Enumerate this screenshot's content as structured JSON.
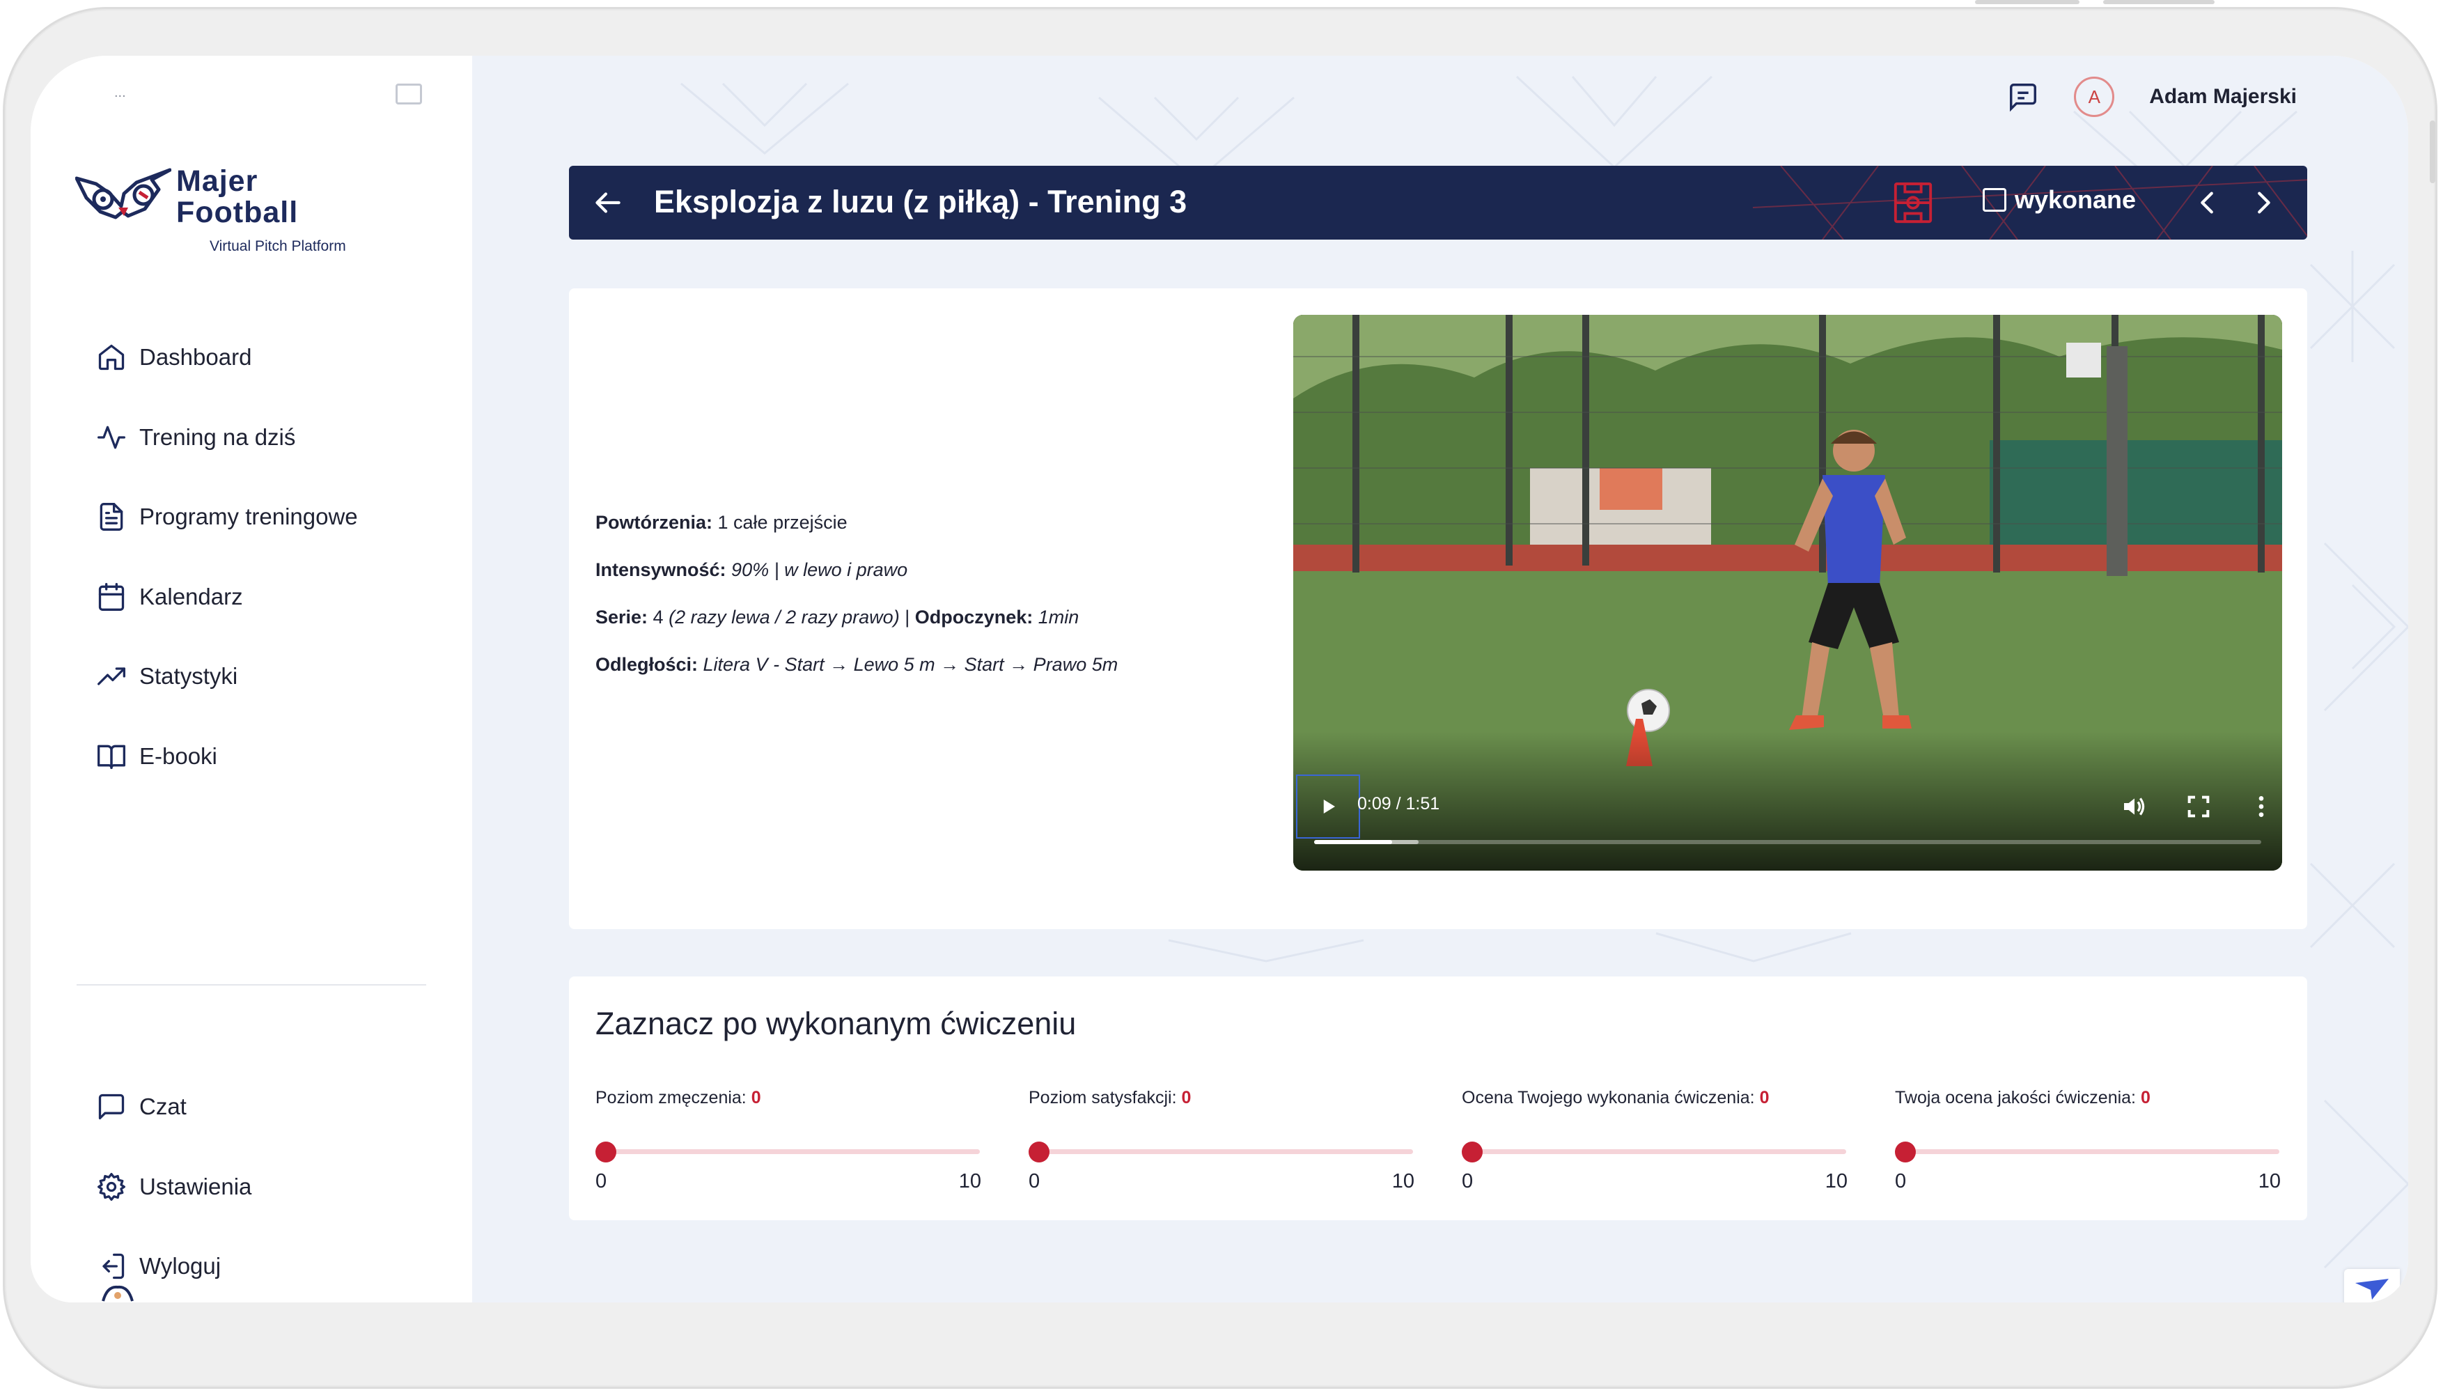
{
  "sidebar": {
    "top_cut_text": "...",
    "logo": {
      "line1": "Majer",
      "line2": "Football",
      "tagline": "Virtual Pitch Platform"
    },
    "nav": [
      {
        "label": "Dashboard",
        "icon": "home-icon"
      },
      {
        "label": "Trening na dziś",
        "icon": "activity-icon"
      },
      {
        "label": "Programy treningowe",
        "icon": "document-icon"
      },
      {
        "label": "Kalendarz",
        "icon": "calendar-icon"
      },
      {
        "label": "Statystyki",
        "icon": "trending-up-icon"
      },
      {
        "label": "E-booki",
        "icon": "book-icon"
      }
    ],
    "bottom_nav": [
      {
        "label": "Czat",
        "icon": "chat-icon"
      },
      {
        "label": "Ustawienia",
        "icon": "gear-icon"
      },
      {
        "label": "Wyloguj",
        "icon": "logout-icon"
      }
    ]
  },
  "topbar": {
    "user_name": "Adam Majerski",
    "avatar_initial": "A"
  },
  "header": {
    "title": "Eksplozja z luzu (z piłką) - Trening 3",
    "done_label": "wykonane",
    "done_checked": false
  },
  "exercise": {
    "reps_label": "Powtórzenia:",
    "reps_value": " 1 całe przejście",
    "intensity_label": "Intensywność:",
    "intensity_value": " 90% | w lewo i prawo",
    "series_label": "Serie:",
    "series_value_plain": " 4 ",
    "series_value_italic": "(2 razy lewa / 2 razy prawo)",
    "series_sep": " | ",
    "rest_label": "Odpoczynek:",
    "rest_value": " 1min",
    "distance_label": "Odległości:",
    "distance_value": " Litera V - Start → Lewo 5 m → Start → Prawo 5m"
  },
  "video": {
    "time": "0:09 / 1:51",
    "progress": 0.082,
    "buffered": 0.11,
    "colors": {
      "grass": "#6a8f4d",
      "track": "#b24a3c",
      "fence": "#3a3f3c"
    }
  },
  "feedback": {
    "title": "Zaznacz po wykonanym ćwiczeniu",
    "ratings": [
      {
        "label": "Poziom zmęczenia: ",
        "value": "0",
        "min": "0",
        "max": "10"
      },
      {
        "label": "Poziom satysfakcji: ",
        "value": "0",
        "min": "0",
        "max": "10"
      },
      {
        "label": "Ocena Twojego wykonania ćwiczenia: ",
        "value": "0",
        "min": "0",
        "max": "10"
      },
      {
        "label": "Twoja ocena jakości ćwiczenia: ",
        "value": "0",
        "min": "0",
        "max": "10"
      }
    ]
  },
  "colors": {
    "brand_navy": "#1b2750",
    "accent_red": "#c62034",
    "page_bg": "#eef2f9"
  }
}
